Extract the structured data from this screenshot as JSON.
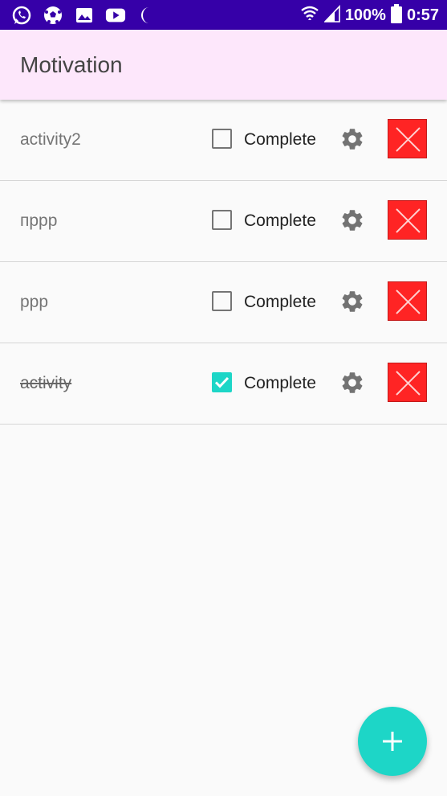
{
  "status_bar": {
    "left_icons": [
      "whatsapp-icon",
      "soccer-ball-icon",
      "gallery-icon",
      "youtube-icon",
      "moon-icon"
    ],
    "battery_percent": "100%",
    "time": "0:57"
  },
  "app_bar": {
    "title": "Motivation",
    "background": "#fde7fb"
  },
  "activities": [
    {
      "name": "activity2",
      "checkbox_label": "Complete",
      "completed": false
    },
    {
      "name": "пррр",
      "checkbox_label": "Complete",
      "completed": false
    },
    {
      "name": "ppp",
      "checkbox_label": "Complete",
      "completed": false
    },
    {
      "name": "activity",
      "checkbox_label": "Complete",
      "completed": true
    }
  ],
  "colors": {
    "status_bar": "#3600a8",
    "accent": "#1dd6c7",
    "delete": "#ff2424"
  },
  "fab": {
    "icon": "plus-icon"
  }
}
